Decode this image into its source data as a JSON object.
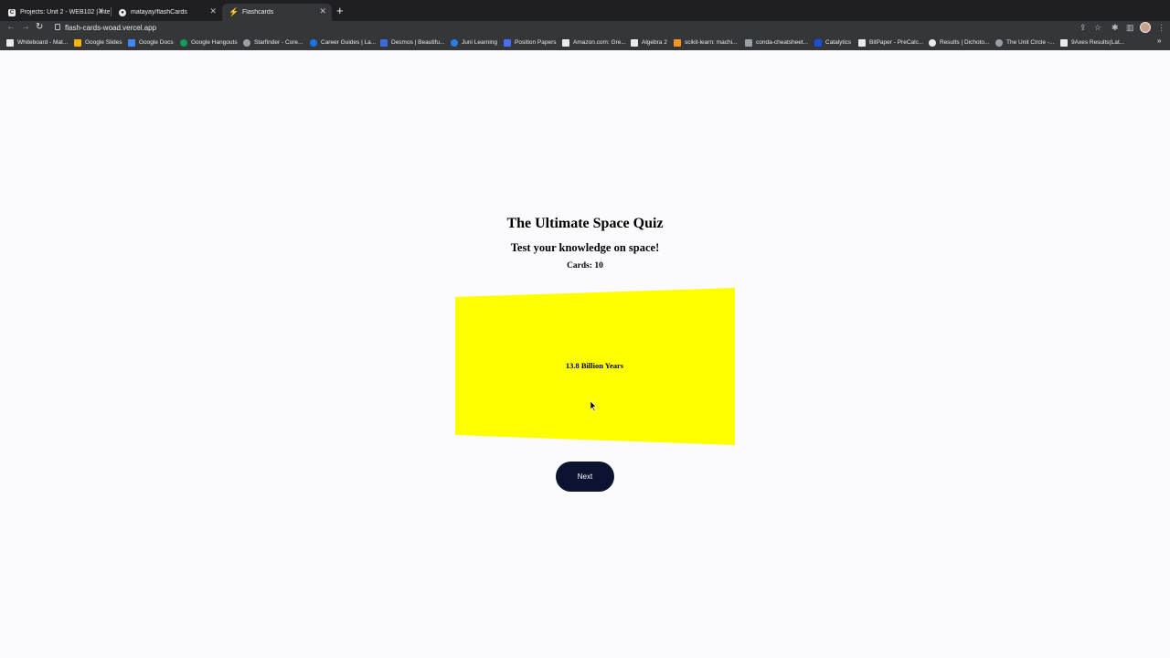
{
  "browser": {
    "tabs": [
      {
        "title": "Projects: Unit 2 - WEB102 | Inte",
        "icon": "codepath-icon"
      },
      {
        "title": "matayay/flashCards",
        "icon": "github-icon"
      },
      {
        "title": "Flashcards",
        "icon": "bolt-icon",
        "active": true
      }
    ],
    "url": "flash-cards-woad.vercel.app",
    "bookmarks": [
      {
        "label": "Whiteboard - Mat...",
        "color": "#e8eaed"
      },
      {
        "label": "Google Slides",
        "color": "#f4b400"
      },
      {
        "label": "Google Docs",
        "color": "#4285f4"
      },
      {
        "label": "Google Hangouts",
        "color": "#0f9d58"
      },
      {
        "label": "Starfinder - Core...",
        "color": "#9aa0a6"
      },
      {
        "label": "Career Guides | La...",
        "color": "#1a73e8"
      },
      {
        "label": "Desmos | Beautifu...",
        "color": "#3b6bdc"
      },
      {
        "label": "Juni Learning",
        "color": "#2b7de9"
      },
      {
        "label": "Position Papers",
        "color": "#4a6cf7"
      },
      {
        "label": "Amazon.com: Gre...",
        "color": "#e8eaed"
      },
      {
        "label": "Algebra 2",
        "color": "#e8eaed"
      },
      {
        "label": "scikit-learn: machi...",
        "color": "#f7931e"
      },
      {
        "label": "conda-cheatsheet...",
        "color": "#9aa0a6"
      },
      {
        "label": "Catalytics",
        "color": "#1d4ed8"
      },
      {
        "label": "BitPaper - PreCalc...",
        "color": "#e8eaed"
      },
      {
        "label": "Results | Dichoto...",
        "color": "#e8eaed"
      },
      {
        "label": "The Unit Circle -...",
        "color": "#9aa0a6"
      },
      {
        "label": "9Axes Results(Lat...",
        "color": "#e8eaed"
      }
    ]
  },
  "page": {
    "title": "The Ultimate Space Quiz",
    "subtitle": "Test your knowledge on space!",
    "cards_count": "Cards: 10",
    "card": {
      "text": "13.8 Billion Years",
      "color": "#ffff00"
    },
    "next_label": "Next",
    "accent": "#0b1331"
  }
}
